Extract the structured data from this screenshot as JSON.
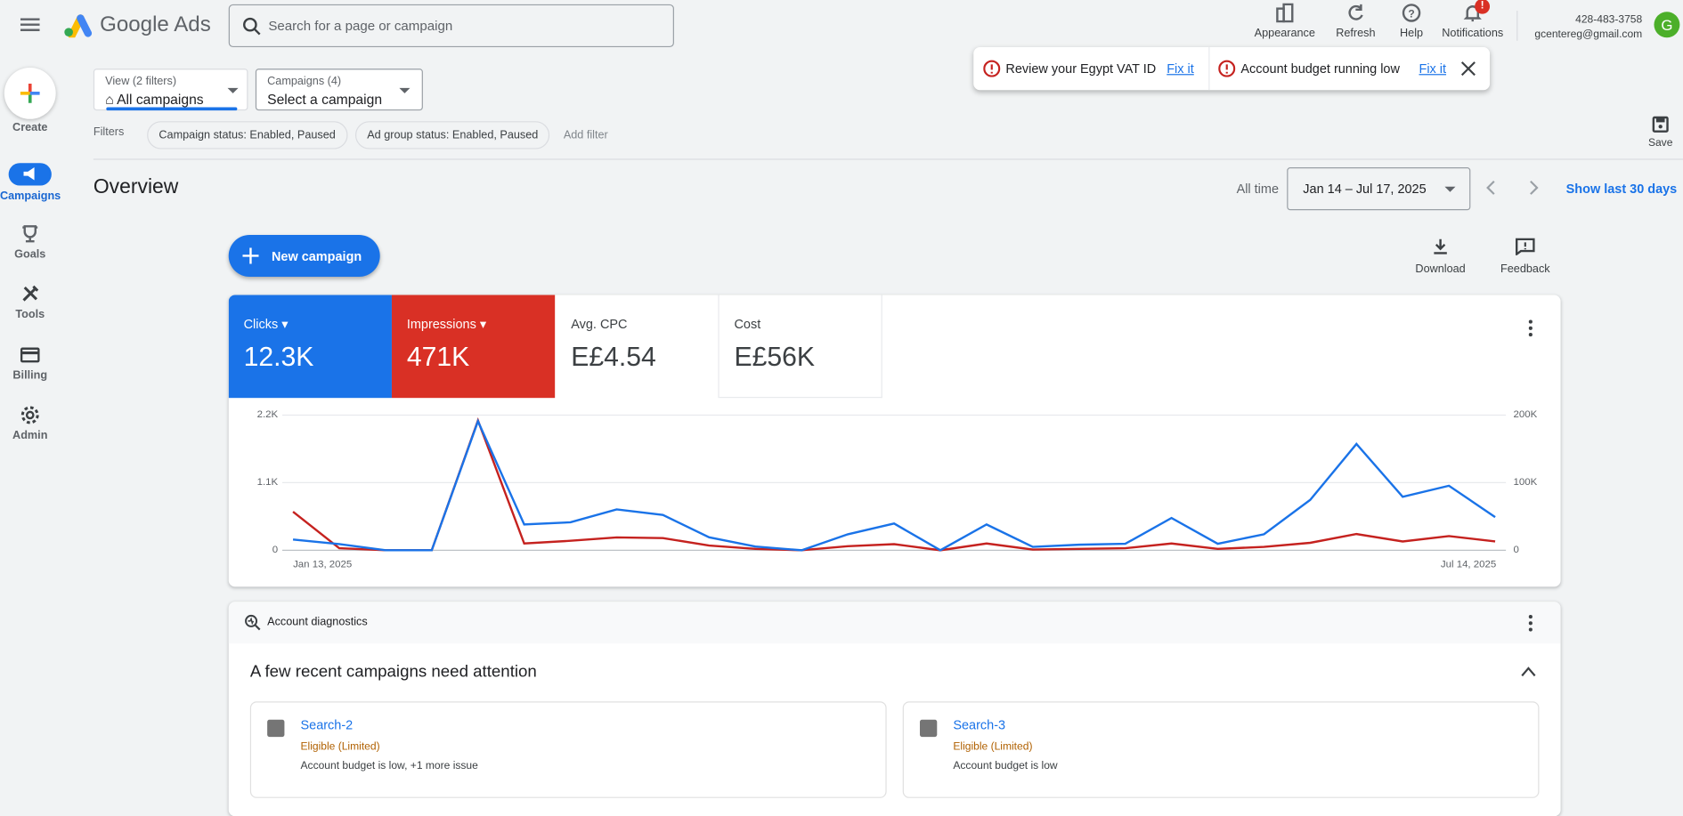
{
  "header": {
    "app_name": "Google Ads",
    "search_placeholder": "Search for a page or campaign",
    "actions": [
      {
        "label": "Appearance",
        "icon": "appearance-icon"
      },
      {
        "label": "Refresh",
        "icon": "refresh-icon"
      },
      {
        "label": "Help",
        "icon": "help-icon"
      },
      {
        "label": "Notifications",
        "icon": "bell-icon"
      }
    ],
    "account_phone": "428-483-3758",
    "account_email": "gcentereg@gmail.com",
    "avatar_letter": "G",
    "avatar_color": "#4caf2a"
  },
  "alerts": [
    {
      "text": "Review your Egypt VAT ID",
      "action": "Fix it"
    },
    {
      "text": "Account budget running low",
      "action": "Fix it"
    }
  ],
  "sidebar": {
    "create_label": "Create",
    "items": [
      {
        "label": "Campaigns",
        "active": true
      },
      {
        "label": "Goals"
      },
      {
        "label": "Tools"
      },
      {
        "label": "Billing"
      },
      {
        "label": "Admin"
      }
    ]
  },
  "filters": {
    "view_label": "View (2 filters)",
    "view_value": "All campaigns",
    "campaigns_label": "Campaigns (4)",
    "campaigns_value": "Select a campaign",
    "filters_label": "Filters",
    "chips": [
      "Campaign status: Enabled, Paused",
      "Ad group status: Enabled, Paused"
    ],
    "add_filter": "Add filter",
    "save_label": "Save"
  },
  "overview": {
    "title": "Overview",
    "range_label": "All time",
    "date_range": "Jan 14 – Jul 17, 2025",
    "show_last": "Show last 30 days",
    "new_campaign": "New campaign",
    "download": "Download",
    "feedback": "Feedback"
  },
  "metrics": [
    {
      "label": "Clicks",
      "value": "12.3K",
      "color": "#1a73e8",
      "selected": true
    },
    {
      "label": "Impressions",
      "value": "471K",
      "color": "#d93025",
      "selected": true
    },
    {
      "label": "Avg. CPC",
      "value": "E£4.54"
    },
    {
      "label": "Cost",
      "value": "E£56K"
    }
  ],
  "chart_data": {
    "type": "line",
    "x_start": "Jan 13, 2025",
    "x_end": "Jul 14, 2025",
    "left_ticks": [
      "2.2K",
      "1.1K",
      "0"
    ],
    "right_ticks": [
      "200K",
      "100K",
      "0"
    ],
    "left_ylim": [
      0,
      2200
    ],
    "right_ylim": [
      0,
      200000
    ],
    "grid": true,
    "series": [
      {
        "name": "Clicks",
        "axis": "left",
        "color": "#1a73e8",
        "values": [
          175,
          100,
          0,
          0,
          2100,
          420,
          455,
          665,
          575,
          210,
          60,
          0,
          260,
          435,
          0,
          420,
          55,
          90,
          105,
          525,
          105,
          260,
          820,
          1730,
          870,
          1050,
          540
        ]
      },
      {
        "name": "Impressions",
        "axis": "right",
        "color": "#c5221f",
        "values": [
          57000,
          3000,
          0,
          0,
          192000,
          10000,
          14000,
          19000,
          18000,
          7000,
          2000,
          0,
          6000,
          9000,
          0,
          10000,
          1000,
          2000,
          3000,
          10000,
          2000,
          5000,
          11000,
          24000,
          13000,
          21000,
          13000
        ]
      }
    ]
  },
  "diagnostics": {
    "title": "Account diagnostics",
    "heading": "A few recent campaigns need attention",
    "campaigns": [
      {
        "name": "Search-2",
        "status": "Eligible (Limited)",
        "issue": "Account budget is low, +1 more issue"
      },
      {
        "name": "Search-3",
        "status": "Eligible (Limited)",
        "issue": "Account budget is low"
      }
    ]
  }
}
